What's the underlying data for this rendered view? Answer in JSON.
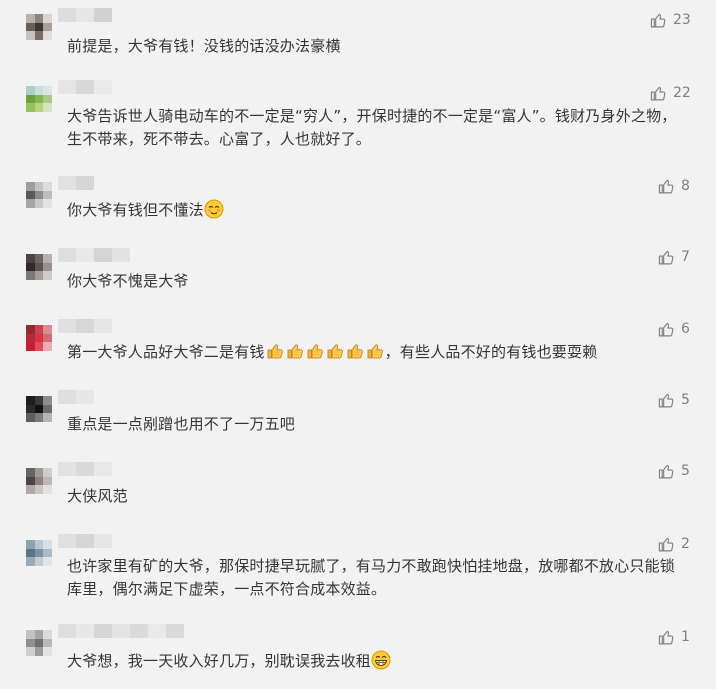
{
  "comments": [
    {
      "text": "前提是，大爷有钱！没钱的话没办法豪横",
      "likes": "23"
    },
    {
      "text": "大爷告诉世人骑电动车的不一定是“穷人”，开保时捷的不一定是“富人”。钱财乃身外之物，生不带来，死不带去。心富了，人也就好了。",
      "likes": "22"
    },
    {
      "text": "你大爷有钱但不懂法",
      "emoji": "blush-emoji",
      "likes": "8"
    },
    {
      "text": "你大爷不愧是大爷",
      "likes": "7"
    },
    {
      "text_a": "第一大爷人品好大爷二是有钱",
      "emoji": "thumbs-up-emoji",
      "emoji_count": 6,
      "text_b": "，有些人品不好的有钱也要耍赖",
      "likes": "6"
    },
    {
      "text": "重点是一点剐蹭也用不了一万五吧",
      "likes": "5"
    },
    {
      "text": "大侠风范",
      "likes": "5"
    },
    {
      "text": "也许家里有矿的大爷，那保时捷早玩腻了，有马力不敢跑快怕挂地盘，放哪都不放心只能锁库里，偶尔满足下虚荣，一点不符合成本效益。",
      "likes": "2"
    },
    {
      "text": "大爷想，我一天收入好几万，别耽误我去收租",
      "emoji": "grin-emoji",
      "likes": "1"
    }
  ],
  "colors": {
    "background": "#f2f2f2",
    "text": "#353535",
    "like": "#7f7f7f"
  }
}
